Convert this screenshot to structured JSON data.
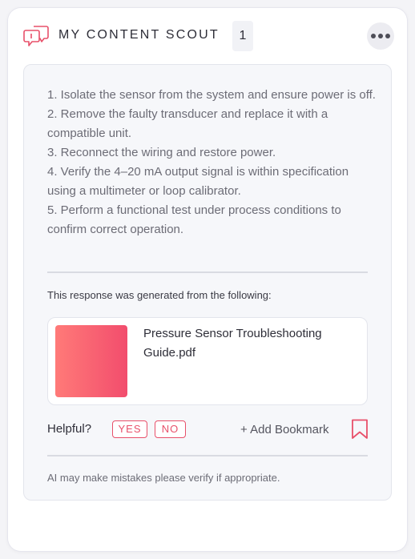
{
  "header": {
    "title": "MY CONTENT SCOUT",
    "count": "1",
    "logo_icon": "chat-bubbles-icon",
    "more_icon": "more-horizontal-icon"
  },
  "answer": {
    "lines": [
      "1. Isolate the sensor from the system and ensure power is off.",
      "2. Remove the faulty transducer and replace it with a compatible unit.",
      "3. Reconnect the wiring and restore power.",
      "4. Verify the 4–20 mA output signal is within specification using a multimeter or loop calibrator.",
      "5. Perform a functional test under process conditions to confirm correct operation."
    ]
  },
  "sources": {
    "intro": "This response was generated from the following:",
    "items": [
      {
        "name": "Pressure Sensor Troubleshooting Guide.pdf"
      }
    ]
  },
  "feedback": {
    "label": "Helpful?",
    "yes": "YES",
    "no": "NO",
    "bookmark_label": "+ Add Bookmark",
    "bookmark_icon": "bookmark-icon"
  },
  "disclaimer": "AI may make mistakes please verify if appropriate.",
  "colors": {
    "accent": "#e8506a",
    "thumb_gradient_start": "#ff7a78",
    "thumb_gradient_end": "#f24d6d"
  }
}
